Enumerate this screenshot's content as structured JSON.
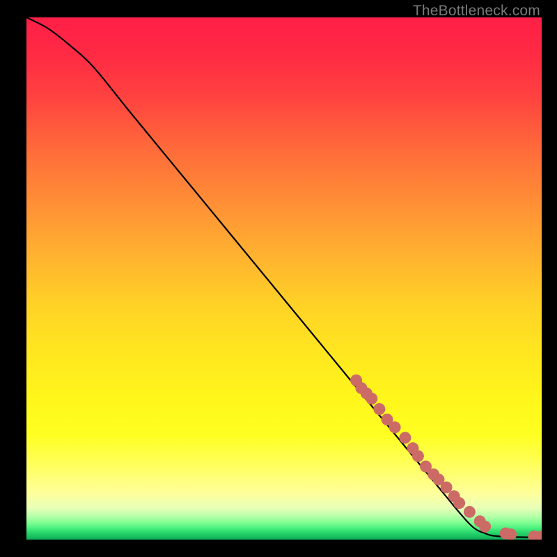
{
  "watermark": "TheBottleneck.com",
  "chart_data": {
    "type": "line",
    "title": "",
    "xlabel": "",
    "ylabel": "",
    "xlim": [
      0,
      100
    ],
    "ylim": [
      0,
      100
    ],
    "curve": {
      "name": "bottleneck-curve",
      "points": [
        {
          "x": 0,
          "y": 100
        },
        {
          "x": 4,
          "y": 98
        },
        {
          "x": 8,
          "y": 95
        },
        {
          "x": 13,
          "y": 90.5
        },
        {
          "x": 20,
          "y": 82
        },
        {
          "x": 30,
          "y": 70
        },
        {
          "x": 40,
          "y": 58
        },
        {
          "x": 50,
          "y": 46
        },
        {
          "x": 60,
          "y": 34
        },
        {
          "x": 70,
          "y": 22
        },
        {
          "x": 80,
          "y": 10
        },
        {
          "x": 86,
          "y": 3
        },
        {
          "x": 89,
          "y": 1.2
        },
        {
          "x": 92,
          "y": 0.6
        },
        {
          "x": 100,
          "y": 0.4
        }
      ]
    },
    "markers": {
      "name": "highlighted-segment",
      "color": "#cc6b66",
      "points": [
        {
          "x": 64,
          "y": 30.5
        },
        {
          "x": 65,
          "y": 29
        },
        {
          "x": 66,
          "y": 28
        },
        {
          "x": 67,
          "y": 27
        },
        {
          "x": 68.5,
          "y": 25
        },
        {
          "x": 70,
          "y": 23
        },
        {
          "x": 71.5,
          "y": 21.5
        },
        {
          "x": 73.5,
          "y": 19.5
        },
        {
          "x": 75,
          "y": 17.5
        },
        {
          "x": 76,
          "y": 16
        },
        {
          "x": 77.5,
          "y": 14
        },
        {
          "x": 79,
          "y": 12.5
        },
        {
          "x": 80,
          "y": 11.5
        },
        {
          "x": 81.5,
          "y": 10
        },
        {
          "x": 83,
          "y": 8.3
        },
        {
          "x": 84,
          "y": 7.0
        },
        {
          "x": 86,
          "y": 5.3
        },
        {
          "x": 88,
          "y": 3.5
        },
        {
          "x": 89,
          "y": 2.5
        },
        {
          "x": 93,
          "y": 1.2
        },
        {
          "x": 94,
          "y": 1.0
        },
        {
          "x": 98.5,
          "y": 0.6
        },
        {
          "x": 100,
          "y": 0.6
        }
      ]
    },
    "gradient_stops": [
      {
        "offset": 0.0,
        "color": "#ff1f47"
      },
      {
        "offset": 0.07,
        "color": "#ff2a44"
      },
      {
        "offset": 0.15,
        "color": "#ff4140"
      },
      {
        "offset": 0.25,
        "color": "#ff6a3a"
      },
      {
        "offset": 0.35,
        "color": "#ff8d36"
      },
      {
        "offset": 0.45,
        "color": "#ffb030"
      },
      {
        "offset": 0.55,
        "color": "#ffd226"
      },
      {
        "offset": 0.65,
        "color": "#ffe81f"
      },
      {
        "offset": 0.73,
        "color": "#fff61b"
      },
      {
        "offset": 0.8,
        "color": "#ffff22"
      },
      {
        "offset": 0.86,
        "color": "#ffff60"
      },
      {
        "offset": 0.91,
        "color": "#ffff9a"
      },
      {
        "offset": 0.94,
        "color": "#e8ffb8"
      },
      {
        "offset": 0.955,
        "color": "#b7ffa8"
      },
      {
        "offset": 0.968,
        "color": "#7dff91"
      },
      {
        "offset": 0.978,
        "color": "#4bf07e"
      },
      {
        "offset": 0.986,
        "color": "#2bd86d"
      },
      {
        "offset": 0.994,
        "color": "#18c060"
      },
      {
        "offset": 1.0,
        "color": "#0faa55"
      }
    ]
  }
}
